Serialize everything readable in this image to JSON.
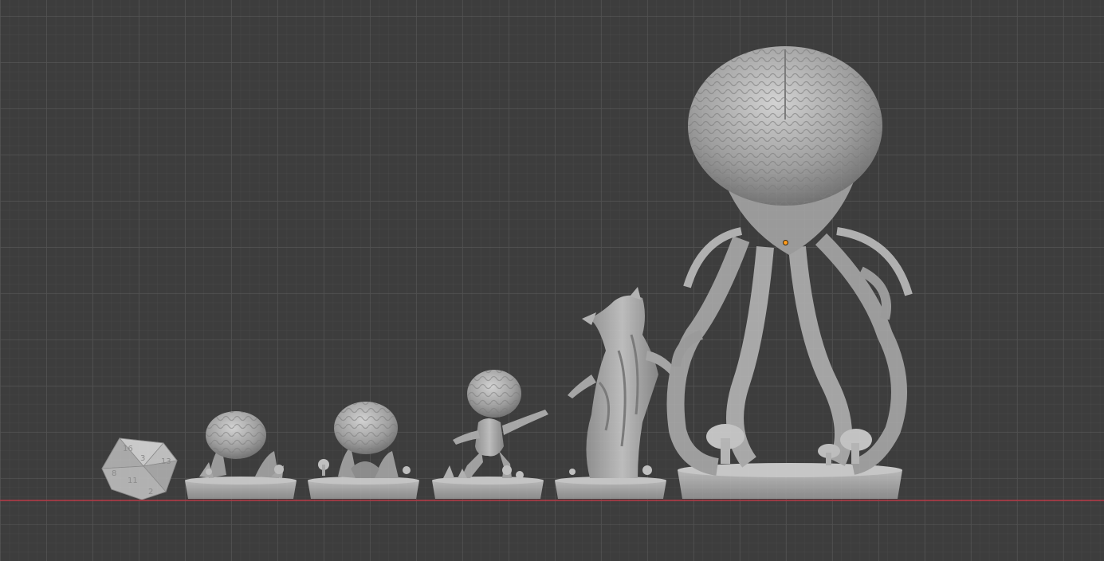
{
  "viewport": {
    "background": "#3d3d3d",
    "grid_line_color": "#4a4a4a",
    "x_axis_color": "#9a3a44",
    "origin_color": "#ff9a1a"
  },
  "die": {
    "numbers": [
      "16",
      "3",
      "8",
      "11",
      "13",
      "2"
    ]
  },
  "objects": [
    {
      "name": "d20-die"
    },
    {
      "name": "brain-creature-small-1"
    },
    {
      "name": "brain-creature-small-2"
    },
    {
      "name": "brain-creature-walker"
    },
    {
      "name": "tree-creature"
    },
    {
      "name": "brain-tentacle-giant"
    }
  ]
}
